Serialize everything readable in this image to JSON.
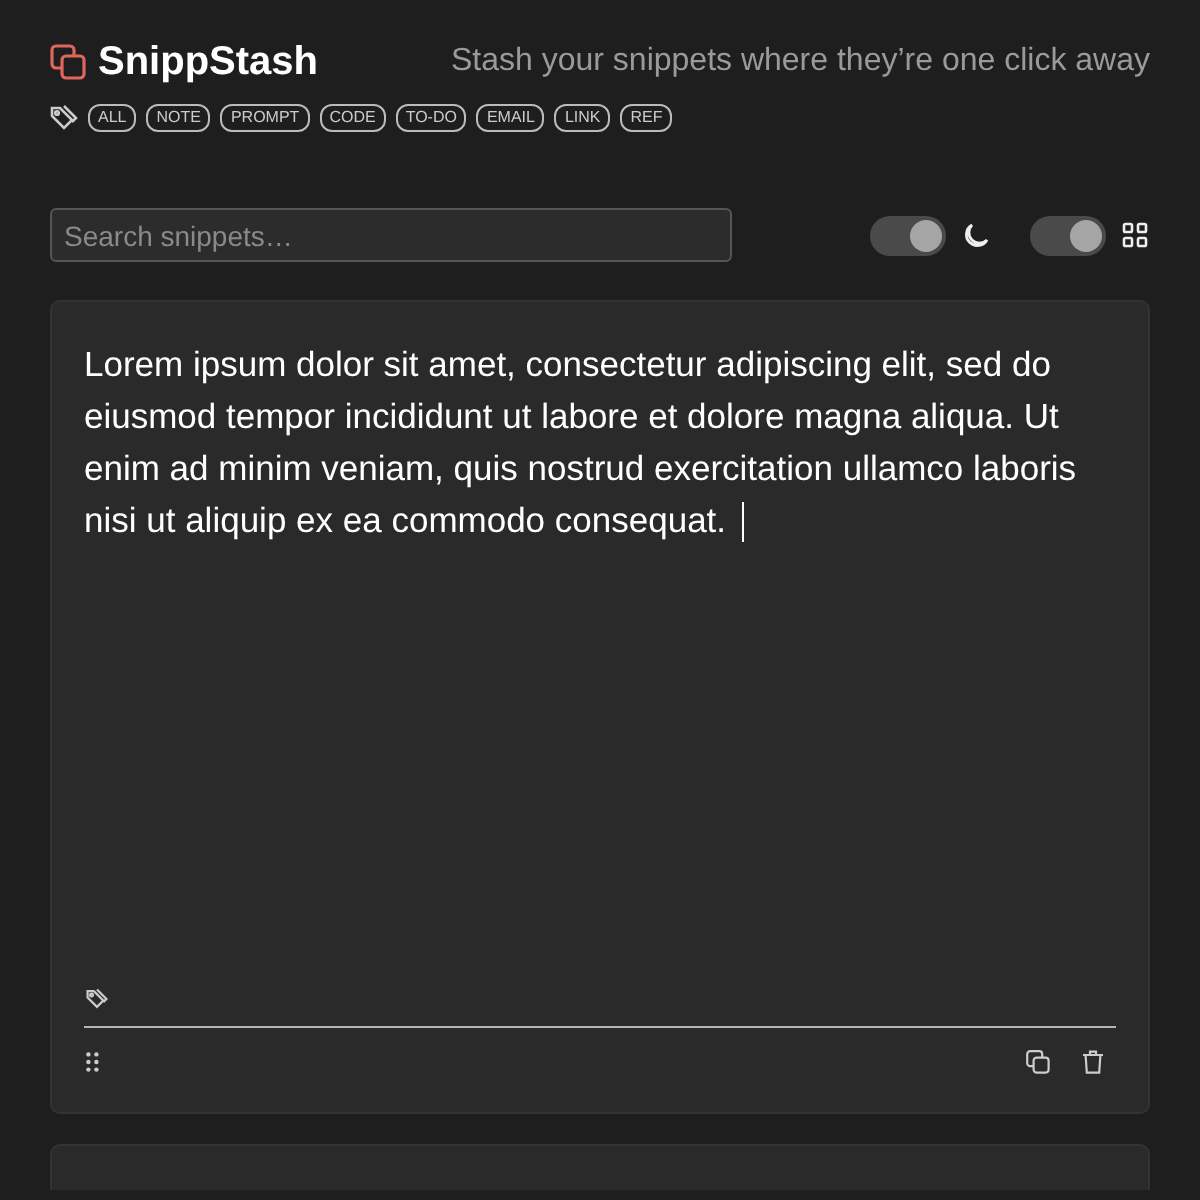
{
  "app": {
    "name": "SnippStash",
    "tagline": "Stash your snippets where they’re one click away"
  },
  "tags": [
    {
      "label": "ALL"
    },
    {
      "label": "NOTE"
    },
    {
      "label": "PROMPT"
    },
    {
      "label": "CODE"
    },
    {
      "label": "TO-DO"
    },
    {
      "label": "EMAIL"
    },
    {
      "label": "LINK"
    },
    {
      "label": "REF"
    }
  ],
  "search": {
    "placeholder": "Search snippets…"
  },
  "toggles": [
    {
      "kind": "theme",
      "on": true
    },
    {
      "kind": "layout",
      "on": true
    }
  ],
  "snippets": [
    {
      "text": "Lorem ipsum dolor sit amet, consectetur adipiscing elit, sed do eiusmod tempor incididunt ut labore et dolore magna aliqua. Ut enim ad minim veniam, quis nostrud exercitation ullamco laboris nisi ut aliquip ex ea commodo consequat.",
      "editing": true
    },
    {
      "editing": false
    }
  ]
}
